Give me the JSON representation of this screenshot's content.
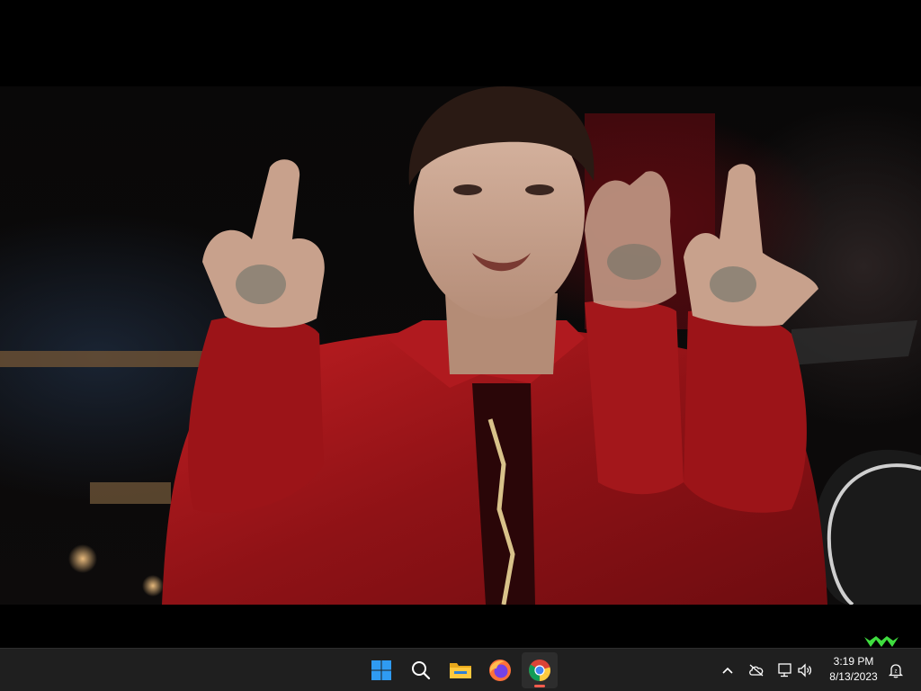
{
  "video": {
    "content": "music-video-frame"
  },
  "taskbar": {
    "pinned": [
      {
        "name": "start-button",
        "icon": "windows-logo-icon"
      },
      {
        "name": "search-button",
        "icon": "search-icon"
      },
      {
        "name": "file-explorer-button",
        "icon": "folder-icon"
      },
      {
        "name": "firefox-button",
        "icon": "firefox-icon"
      },
      {
        "name": "chrome-button",
        "icon": "chrome-icon",
        "active": true
      }
    ],
    "tray": [
      {
        "name": "show-hidden-icons",
        "icon": "chevron-up-icon"
      },
      {
        "name": "onedrive-status",
        "icon": "cloud-offline-icon"
      },
      {
        "name": "network-status",
        "icon": "network-icon"
      },
      {
        "name": "volume-control",
        "icon": "speaker-icon"
      },
      {
        "name": "notifications",
        "icon": "bell-icon"
      }
    ],
    "clock": {
      "time": "3:19 PM",
      "date": "8/13/2023"
    }
  },
  "colors": {
    "taskbar_bg": "#1f1f1f",
    "accent_running": "#ff5c4d",
    "windows_blue": "#2f9bf2",
    "jacket_red": "#a8161b"
  }
}
